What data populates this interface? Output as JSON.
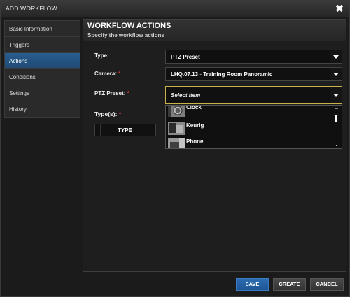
{
  "window": {
    "title": "ADD WORKFLOW",
    "close_icon": "close-icon"
  },
  "sidebar": {
    "items": [
      {
        "label": "Basic Information",
        "active": false
      },
      {
        "label": "Triggers",
        "active": false
      },
      {
        "label": "Actions",
        "active": true
      },
      {
        "label": "Conditions",
        "active": false
      },
      {
        "label": "Settings",
        "active": false
      },
      {
        "label": "History",
        "active": false
      }
    ]
  },
  "main": {
    "title": "WORKFLOW ACTIONS",
    "subtitle": "Specify the workflow actions",
    "form": {
      "type_label": "Type:",
      "type_value": "PTZ Preset",
      "camera_label": "Camera:",
      "camera_value": "LHQ.07.13 - Training Room Panoramic",
      "preset_label": "PTZ Preset:",
      "preset_placeholder": "Select item",
      "types_label": "Type(s):",
      "required_mark": "*"
    },
    "type_table": {
      "header": "TYPE"
    },
    "preset_dropdown": {
      "options": [
        {
          "label": "Clock",
          "icon": "clock-thumbnail"
        },
        {
          "label": "Keurig",
          "icon": "keurig-thumbnail"
        },
        {
          "label": "Phone",
          "icon": "phone-thumbnail"
        }
      ]
    }
  },
  "footer": {
    "save_label": "SAVE",
    "create_label": "CREATE",
    "cancel_label": "CANCEL"
  },
  "colors": {
    "accent_active": "#285d8f",
    "primary_button": "#2c6cb1",
    "required": "#e23b3b",
    "focus_border": "#c9b24a"
  }
}
